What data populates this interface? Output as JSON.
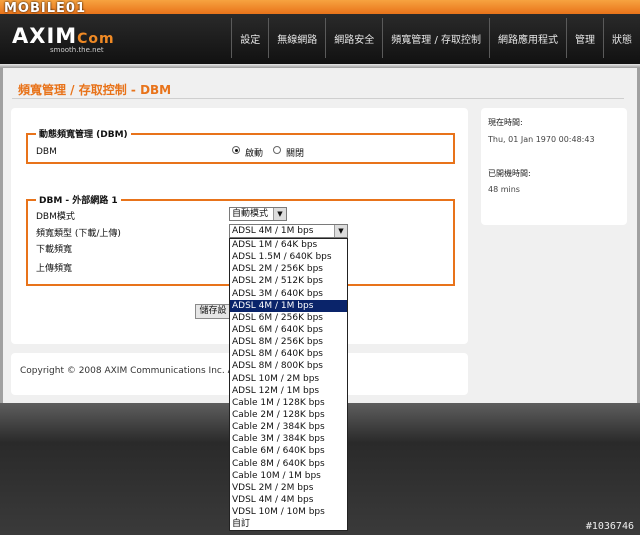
{
  "brand": {
    "watermark": "MOBILE01",
    "logo_main": "AXIM",
    "logo_sub": "Com",
    "tagline": "smooth.the.net"
  },
  "nav": [
    "設定",
    "無線網路",
    "網路安全",
    "頻寬管理 / 存取控制",
    "網路應用程式",
    "管理",
    "狀態"
  ],
  "page": {
    "title": "頻寬管理 / 存取控制 - DBM"
  },
  "dbm_section": {
    "legend": "動態頻寬管理 (DBM)",
    "label": "DBM",
    "enable_label": "啟動",
    "disable_label": "關閉",
    "selected": "啟動"
  },
  "ext_section": {
    "legend": "DBM - 外部網路 1",
    "mode_label": "DBM模式",
    "mode_value": "自動模式",
    "type_label": "頻寬類型 (下載/上傳)",
    "type_value": "ADSL 4M / 1M bps",
    "download_label": "下載頻寬",
    "upload_label": "上傳頻寬"
  },
  "save_label": "儲存設定",
  "dropdown_options": [
    "ADSL 1M / 64K bps",
    "ADSL 1.5M / 640K bps",
    "ADSL 2M / 256K bps",
    "ADSL 2M / 512K bps",
    "ADSL 3M / 640K bps",
    "ADSL 4M / 1M bps",
    "ADSL 6M / 256K bps",
    "ADSL 6M / 640K bps",
    "ADSL 8M / 256K bps",
    "ADSL 8M / 640K bps",
    "ADSL 8M / 800K bps",
    "ADSL 10M / 2M bps",
    "ADSL 12M / 1M bps",
    "Cable 1M / 128K bps",
    "Cable 2M / 128K bps",
    "Cable 2M / 384K bps",
    "Cable 3M / 384K bps",
    "Cable 6M / 640K bps",
    "Cable 8M / 640K bps",
    "Cable 10M / 1M bps",
    "VDSL 2M / 2M bps",
    "VDSL 4M / 4M bps",
    "VDSL 10M / 10M bps",
    "自訂"
  ],
  "dropdown_selected": "ADSL 4M / 1M bps",
  "footer": {
    "copyright": "Copyright © 2008 AXIM Communications Inc. All"
  },
  "side": {
    "time_label": "現在時間:",
    "time_value": "Thu, 01 Jan 1970 00:48:43",
    "uptime_label": "已開機時間:",
    "uptime_value": "48 mins"
  },
  "watermark_id": "#1036746",
  "colors": {
    "accent": "#e8731a",
    "header_bg": "#1a1a1a",
    "selected_option": "#0a246a"
  }
}
